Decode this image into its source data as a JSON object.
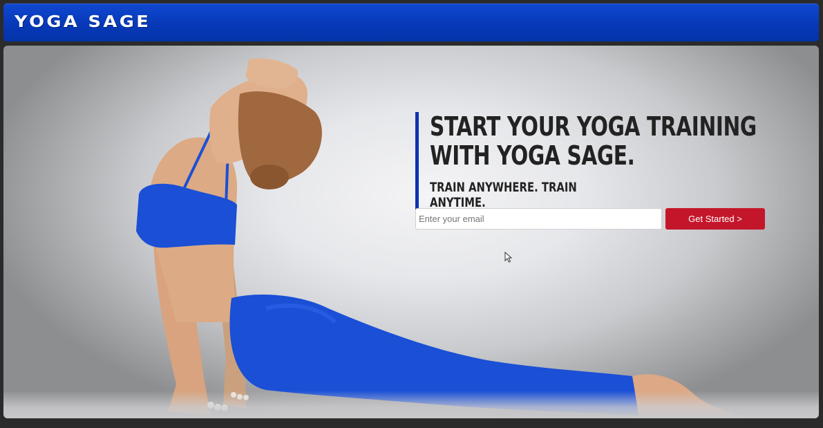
{
  "header": {
    "logo_text": "YOGA SAGE"
  },
  "hero": {
    "headline": "START YOUR YOGA TRAINING WITH YOGA SAGE.",
    "subheadline": "TRAIN ANYWHERE. TRAIN ANYTIME.",
    "email_placeholder": "Enter your email",
    "email_value": "",
    "cta_label": "Get Started >"
  },
  "colors": {
    "navbar": "#0739b8",
    "accent_bar": "#0a33b0",
    "cta": "#c4162a",
    "outfit": "#1a4fd6"
  },
  "icons": {
    "cursor": "mouse-pointer-icon"
  }
}
